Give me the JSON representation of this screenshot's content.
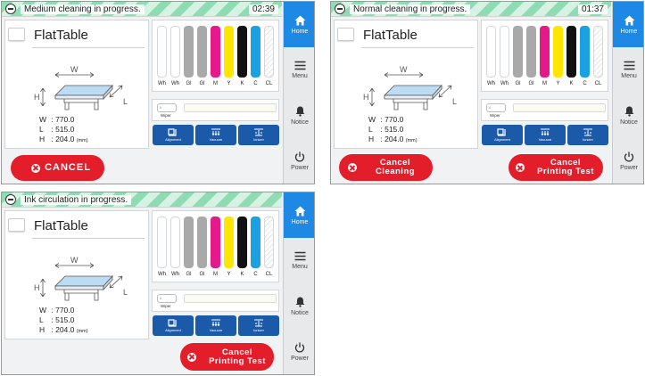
{
  "colors": {
    "accent": "#1e88e5",
    "danger": "#e31e2a",
    "function_button": "#1b5aa8",
    "status_stripe": "#8fdcb4"
  },
  "sidebar": [
    {
      "label": "Home",
      "icon": "home-icon"
    },
    {
      "label": "Menu",
      "icon": "menu-icon"
    },
    {
      "label": "Notice",
      "icon": "bell-icon"
    },
    {
      "label": "Power",
      "icon": "power-icon"
    }
  ],
  "table": {
    "title": "FlatTable",
    "w_label": "W",
    "l_label": "L",
    "h_label": "H"
  },
  "dimensions": {
    "w_key": "W",
    "w_value": ": 770.0",
    "l_key": "L",
    "l_value": ": 515.0",
    "h_key": "H",
    "h_value": ": 204.0",
    "unit": "(mm)"
  },
  "inks": [
    {
      "label": "Wh",
      "color": "#ffffff"
    },
    {
      "label": "Wh",
      "color": "#ffffff"
    },
    {
      "label": "Gl",
      "color": "#a9a9a9"
    },
    {
      "label": "Gl",
      "color": "#a9a9a9"
    },
    {
      "label": "M",
      "color": "#e6198a"
    },
    {
      "label": "Y",
      "color": "#ffe600"
    },
    {
      "label": "K",
      "color": "#111111"
    },
    {
      "label": "C",
      "color": "#1ba0e2"
    },
    {
      "label": "CL",
      "color": "#ffffff"
    }
  ],
  "wiper": {
    "button": "0",
    "label": "Wiper"
  },
  "function_buttons": [
    {
      "label": "Alignment",
      "icon": "alignment-icon"
    },
    {
      "label": "Vacuum",
      "icon": "vacuum-icon"
    },
    {
      "label": "Ionizer",
      "icon": "ionizer-icon"
    }
  ],
  "screens": [
    {
      "status": "Medium cleaning in progress.",
      "time": "02:39",
      "cancel": "CANCEL"
    },
    {
      "status": "Normal cleaning in progress.",
      "time": "01:37",
      "cancel_cleaning": "Cancel\nCleaning",
      "cancel_printing": "Cancel\nPrinting Test"
    },
    {
      "status": "Ink circulation in progress.",
      "time": "",
      "cancel_printing": "Cancel\nPrinting Test"
    }
  ]
}
